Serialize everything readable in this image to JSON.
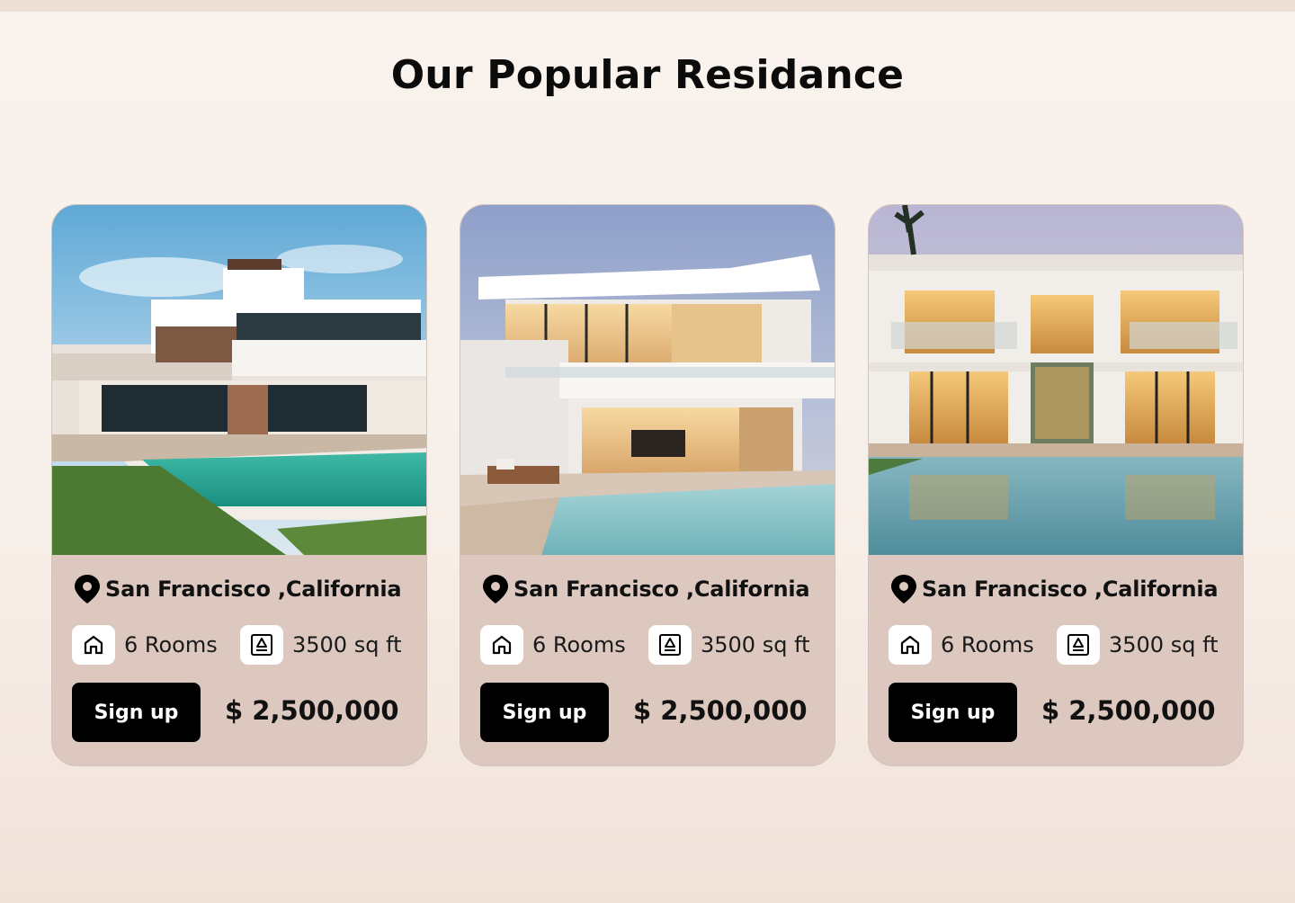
{
  "section": {
    "title": "Our Popular Residance"
  },
  "cards": [
    {
      "image": "modern-villa-with-pool-daytime",
      "location": "San Francisco ,California",
      "rooms": "6 Rooms",
      "area": "3500 sq ft",
      "cta": "Sign up",
      "price": "$ 2,500,000"
    },
    {
      "image": "modern-villa-with-pool-dusk",
      "location": "San Francisco ,California",
      "rooms": "6 Rooms",
      "area": "3500 sq ft",
      "cta": "Sign up",
      "price": "$ 2,500,000"
    },
    {
      "image": "modern-villa-with-pool-evening-lit",
      "location": "San Francisco ,California",
      "rooms": "6 Rooms",
      "area": "3500 sq ft",
      "cta": "Sign up",
      "price": "$ 2,500,000"
    }
  ],
  "icons": {
    "location": "map-pin-icon",
    "rooms": "home-icon",
    "area": "area-icon"
  },
  "colors": {
    "background": "#f9f3ee",
    "card": "#dcc8bf",
    "button": "#000000",
    "button_text": "#ffffff",
    "text": "#111111"
  }
}
